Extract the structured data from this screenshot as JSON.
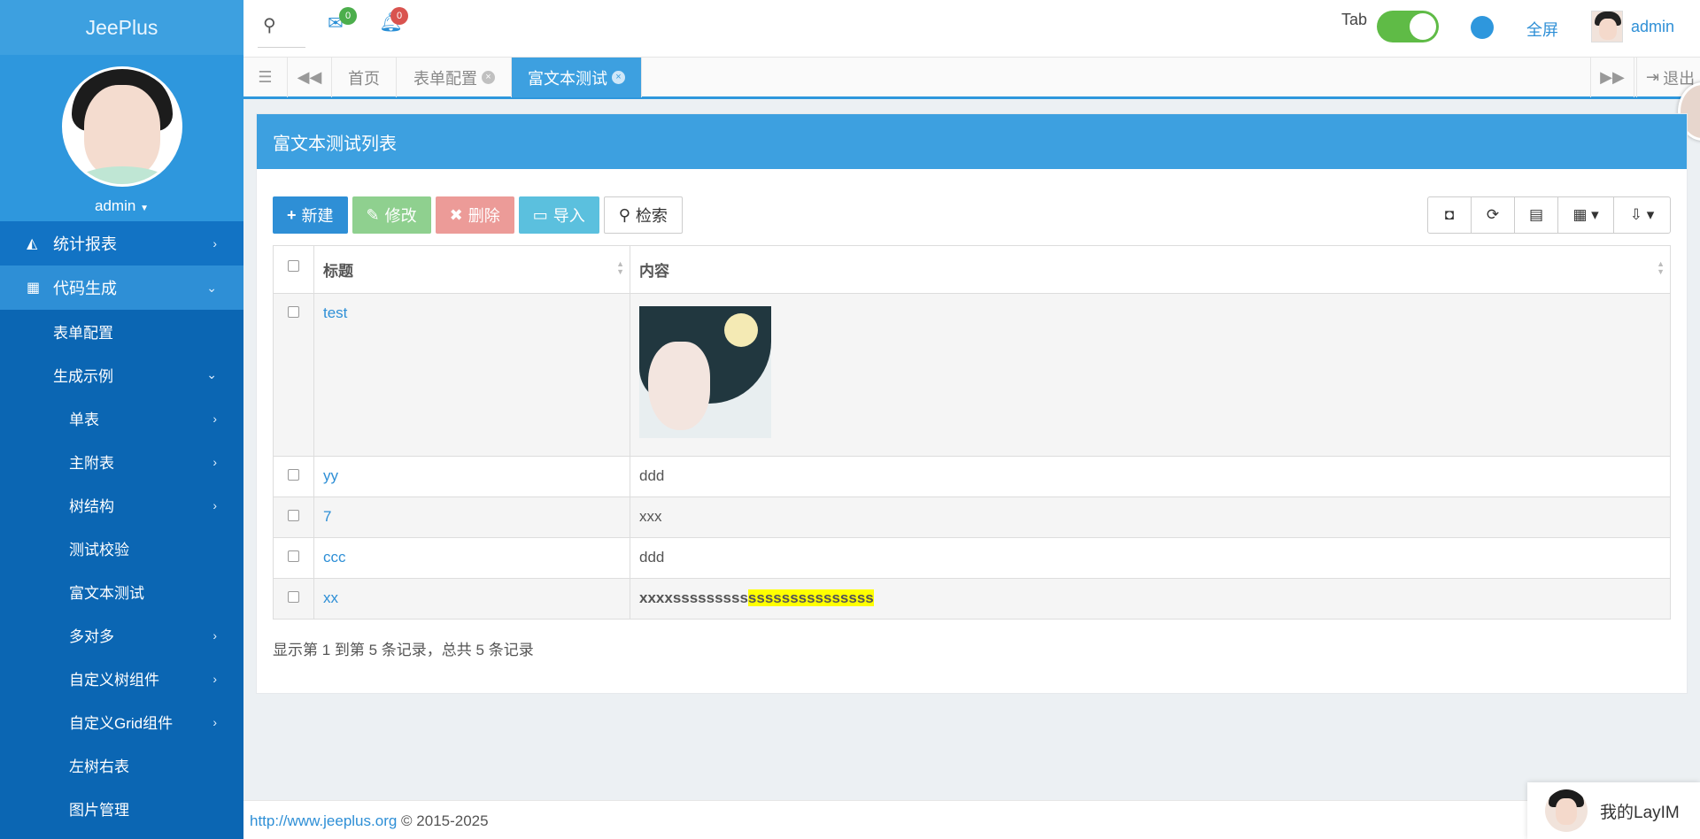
{
  "sidebar": {
    "brand": "JeePlus",
    "profile_name": "admin",
    "menu": [
      {
        "label": "统计报表",
        "icon": "chart-area-icon"
      },
      {
        "label": "代码生成",
        "icon": "grid-icon"
      }
    ],
    "submenu": {
      "form_config": "表单配置",
      "gen_examples": "生成示例",
      "items": [
        "单表",
        "主附表",
        "树结构",
        "测试校验",
        "富文本测试",
        "多对多",
        "自定义树组件",
        "自定义Grid组件",
        "左树右表",
        "图片管理"
      ]
    }
  },
  "topbar": {
    "mail_badge": "0",
    "bell_badge": "0",
    "tab_label": "Tab",
    "fullscreen": "全屏",
    "user_name": "admin"
  },
  "tabs": {
    "home": "首页",
    "form_config": "表单配置",
    "rich_text": "富文本测试",
    "logout": "退出"
  },
  "panel": {
    "title": "富文本测试列表",
    "buttons": {
      "new": "新建",
      "edit": "修改",
      "delete": "删除",
      "import": "导入",
      "search": "检索"
    },
    "columns": [
      "标题",
      "内容"
    ],
    "rows": [
      {
        "title": "test",
        "content": ""
      },
      {
        "title": "yy",
        "content": "ddd"
      },
      {
        "title": "7",
        "content": "xxx"
      },
      {
        "title": "ccc",
        "content": "ddd"
      },
      {
        "title": "xx",
        "content_plain": "xxxxsssssssss",
        "content_highlight": "sssssssssssssss"
      }
    ],
    "pagination": "显示第 1 到第 5 条记录，总共 5 条记录"
  },
  "footer": {
    "link": "http://www.jeeplus.org",
    "copyright": "© 2015-2025"
  },
  "im": {
    "label": "我的LayIM"
  },
  "colors": {
    "brand_blue": "#3da0e0",
    "sidebar_blue": "#0b66b3",
    "success_green": "#5fbb46",
    "highlight_yellow": "#ffff00"
  }
}
